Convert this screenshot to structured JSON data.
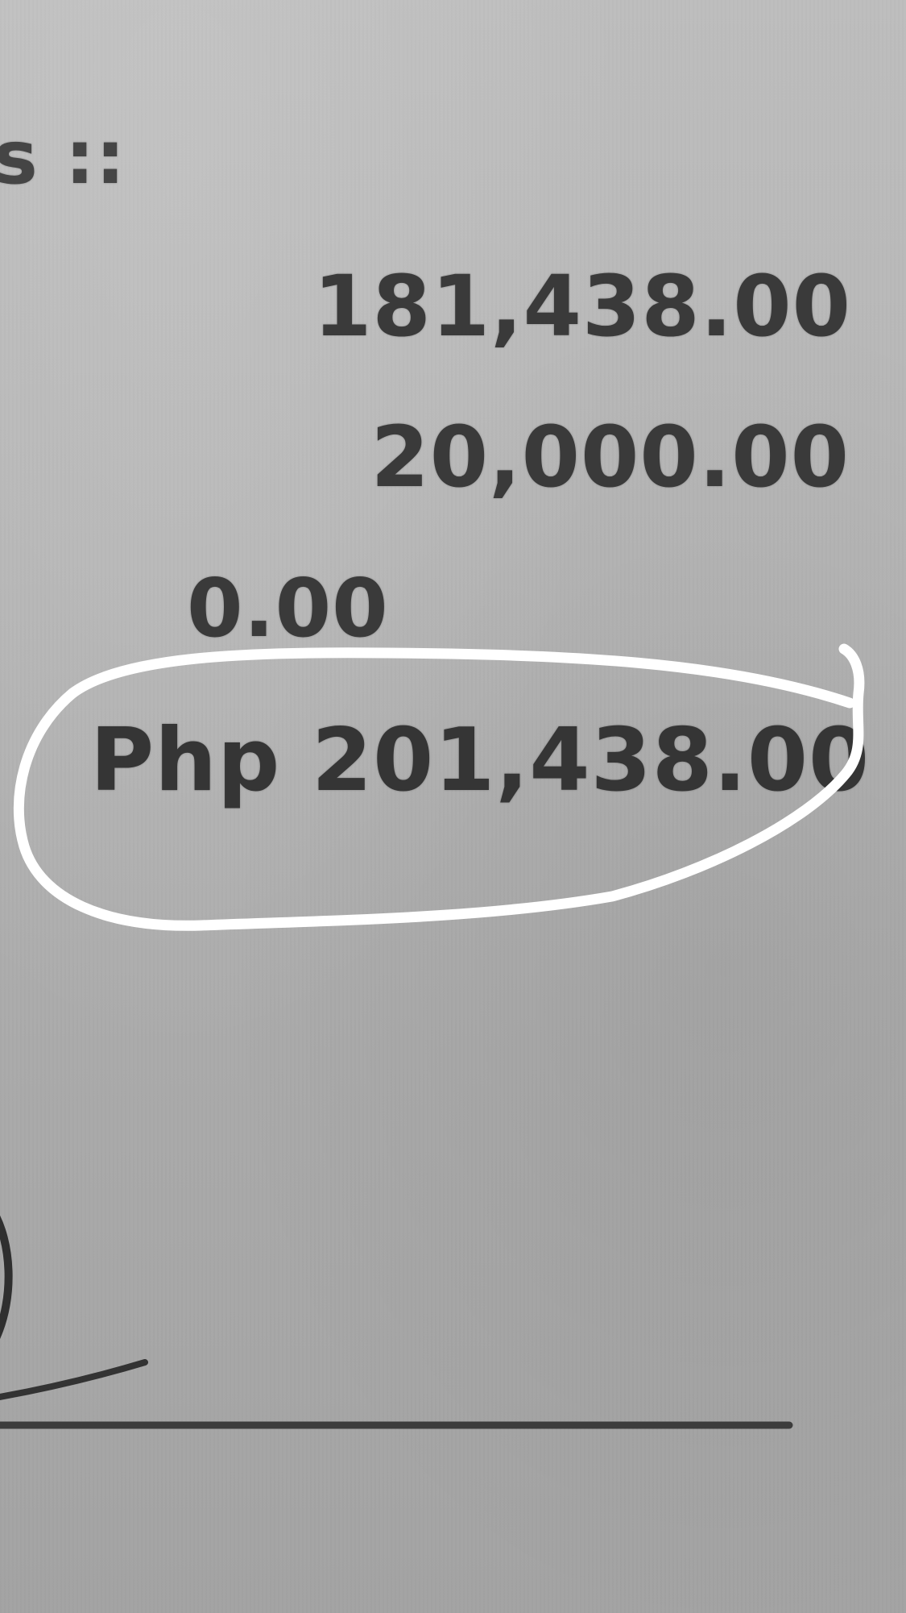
{
  "document": {
    "heading_fragment": "s ::",
    "amounts": [
      "181,438.00",
      "20,000.00",
      "0.00"
    ],
    "total": "Php 201,438.00"
  },
  "colors": {
    "paper": "#b5b5b5",
    "ink": "#3a3a3a",
    "annotation": "#ffffff"
  }
}
